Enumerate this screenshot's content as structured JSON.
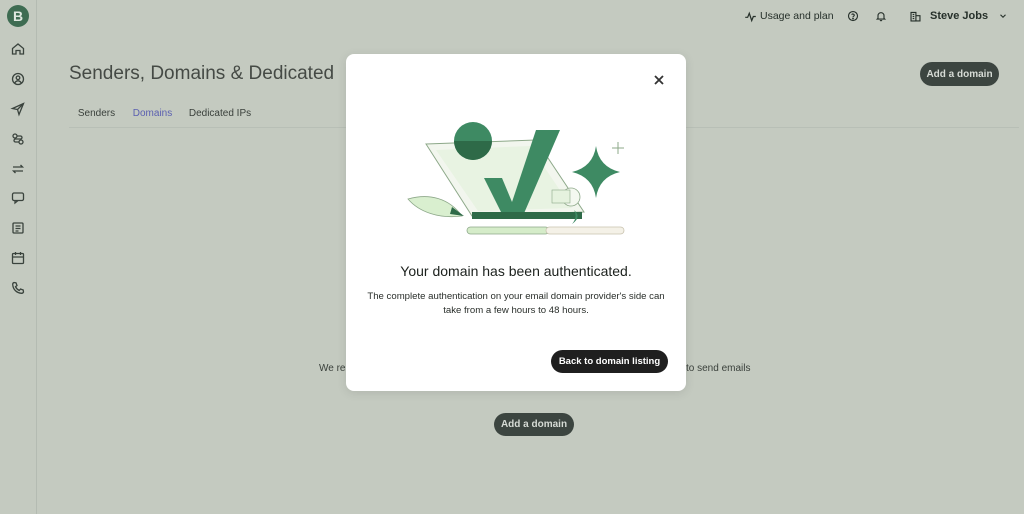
{
  "sidebar": {
    "logo_letter": "B",
    "icons": [
      "home-icon",
      "contacts-icon",
      "campaigns-icon",
      "automation-icon",
      "transactional-icon",
      "conversations-icon",
      "forms-icon",
      "meetings-icon",
      "phone-icon"
    ]
  },
  "topbar": {
    "usage_label": "Usage and plan",
    "user_name": "Steve Jobs"
  },
  "page": {
    "title": "Senders, Domains & Dedicated",
    "add_domain_label": "Add a domain",
    "tabs": [
      {
        "label": "Senders",
        "active": false
      },
      {
        "label": "Domains",
        "active": true
      },
      {
        "label": "Dedicated IPs",
        "active": false
      }
    ],
    "empty_text_left": "We re",
    "empty_text_right": "to send emails",
    "empty_add_domain_label": "Add a domain"
  },
  "modal": {
    "title": "Your domain has been authenticated.",
    "description": "The complete authentication on your email domain provider's side can take from a few hours to 48 hours.",
    "button_label": "Back to domain listing"
  },
  "colors": {
    "backdrop": "#c4cac0",
    "brand_green": "#3e8a63",
    "dark_button": "#1f1f1f",
    "active_tab": "#5a5fb0"
  }
}
